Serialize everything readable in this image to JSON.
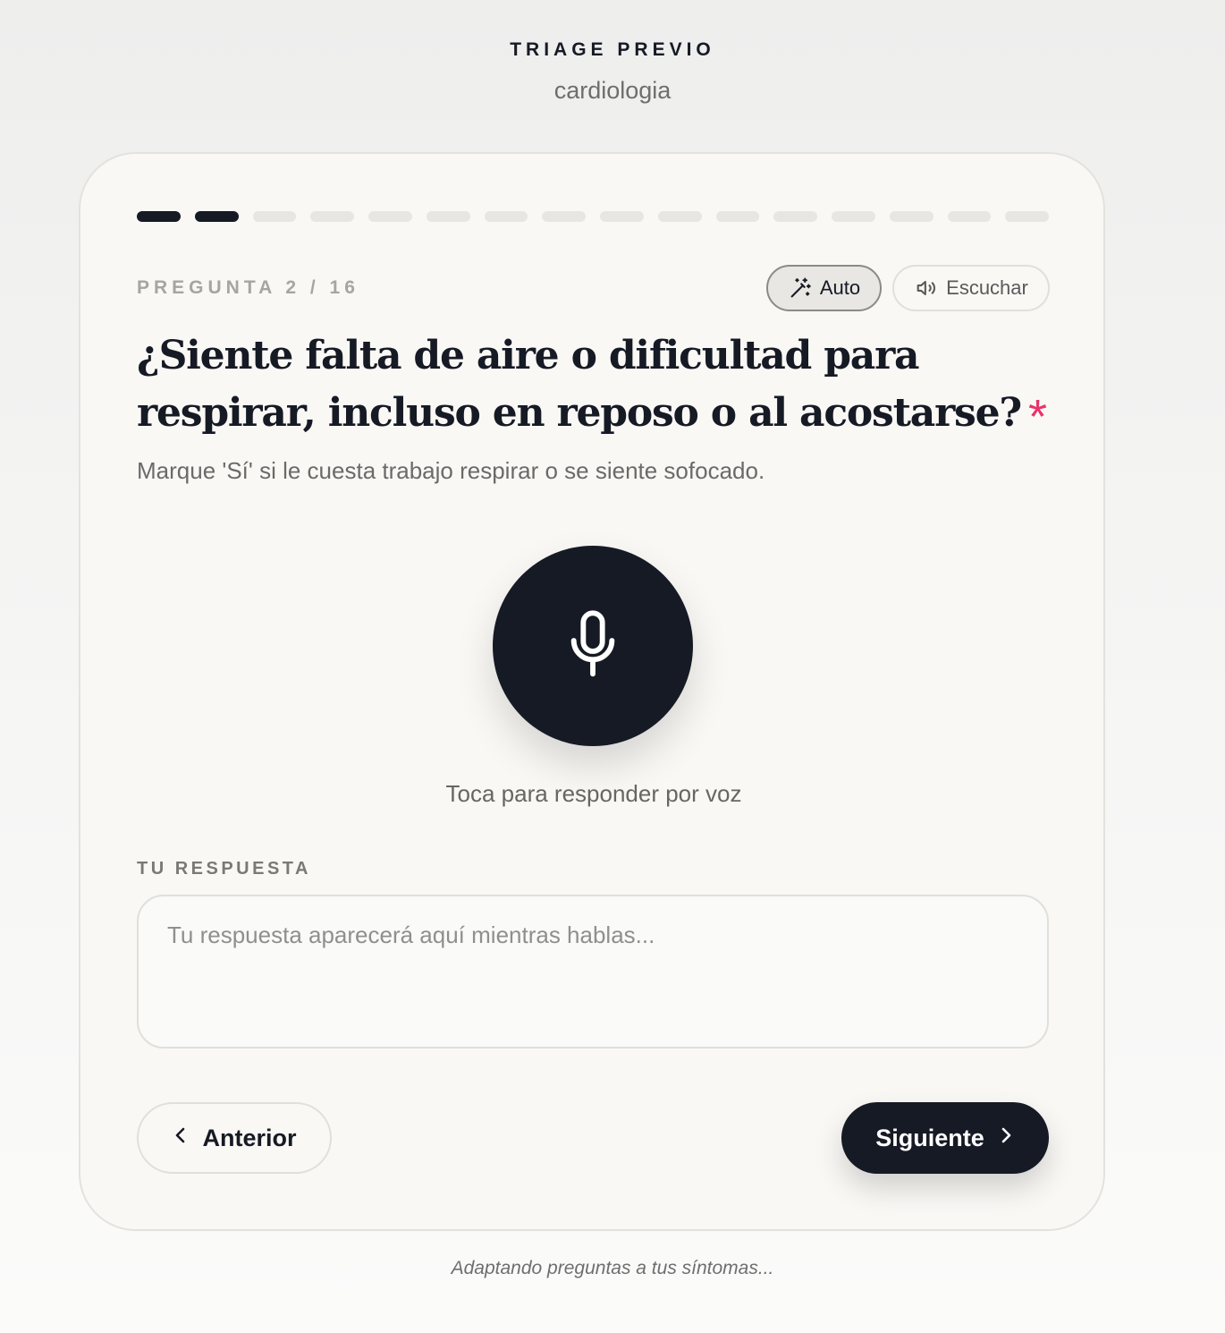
{
  "header": {
    "kicker": "TRIAGE PREVIO",
    "specialty": "cardiologia"
  },
  "progress": {
    "current": 2,
    "total": 16
  },
  "question": {
    "counter": "PREGUNTA 2 / 16",
    "text": "¿Siente falta de aire o dificultad para respirar, incluso en reposo o al acostarse?",
    "required_mark": "*",
    "hint": "Marque 'Sí' si le cuesta trabajo respirar o se siente sofocado."
  },
  "controls": {
    "auto_label": "Auto",
    "auto_icon": "magic-wand-icon",
    "listen_label": "Escuchar",
    "listen_icon": "speaker-icon"
  },
  "voice": {
    "icon": "microphone-icon",
    "caption": "Toca para responder por voz"
  },
  "answer": {
    "label": "TU RESPUESTA",
    "value": "",
    "placeholder": "Tu respuesta aparecerá aquí mientras hablas..."
  },
  "navigation": {
    "prev_label": "Anterior",
    "next_label": "Siguiente"
  },
  "footer": {
    "note": "Adaptando preguntas a tus síntomas..."
  },
  "colors": {
    "primary": "#161a24",
    "accent_required": "#e8336a",
    "card_background": "#f9f8f5",
    "progress_inactive": "#e7e6e2"
  }
}
